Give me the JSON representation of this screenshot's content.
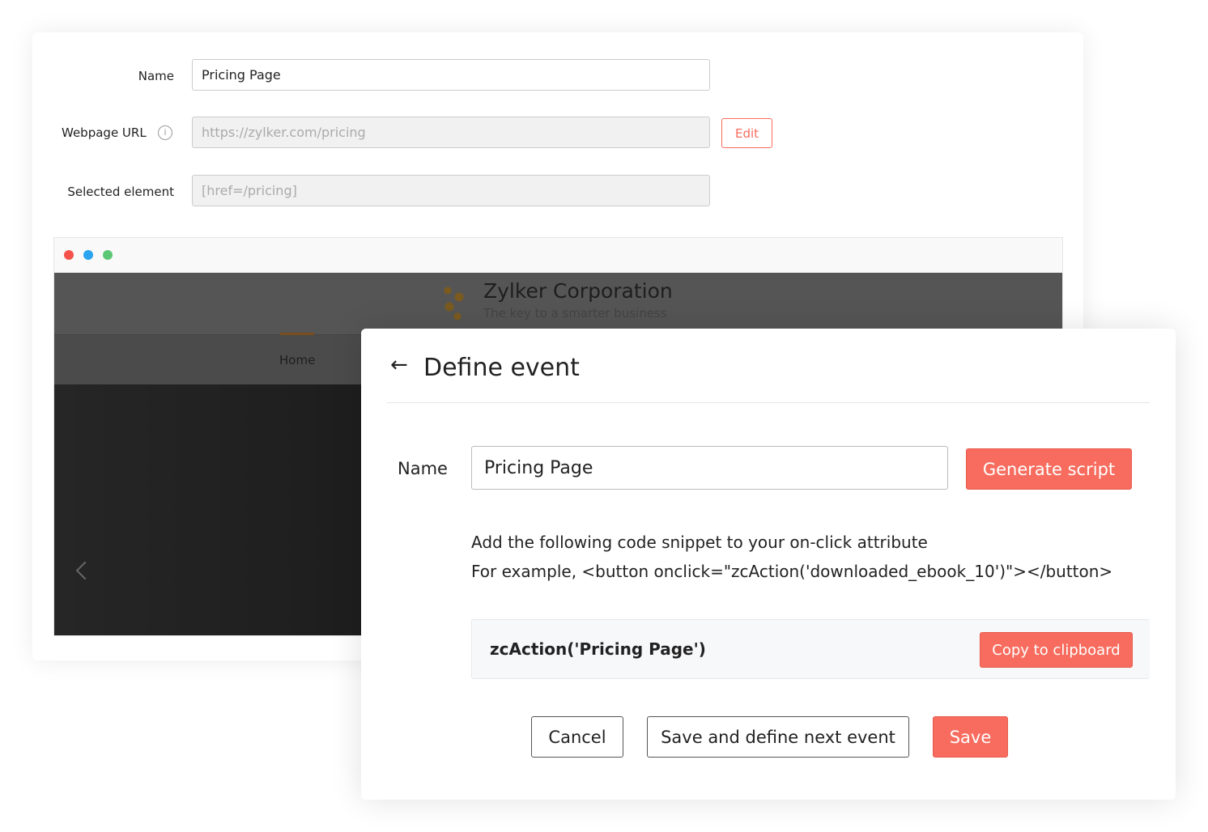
{
  "form": {
    "name_label": "Name",
    "name_value": "Pricing Page",
    "url_label": "Webpage URL",
    "url_value": "https://zylker.com/pricing",
    "edit_label": "Edit",
    "element_label": "Selected element",
    "element_value": "[href=/pricing]"
  },
  "preview": {
    "company": "Zylker Corporation",
    "tagline": "The key to a smarter business",
    "nav_home": "Home"
  },
  "dialog": {
    "title": "Define event",
    "name_label": "Name",
    "name_value": "Pricing Page",
    "generate_label": "Generate script",
    "instruction": "Add the following code snippet to your on-click attribute",
    "example": "For example, <button onclick=\"zcAction('downloaded_ebook_10')\"></button>",
    "code": "zcAction('Pricing Page')",
    "copy_label": "Copy to clipboard",
    "cancel_label": "Cancel",
    "save_next_label": "Save and define next event",
    "save_label": "Save"
  },
  "colors": {
    "accent": "#f76c5e"
  }
}
